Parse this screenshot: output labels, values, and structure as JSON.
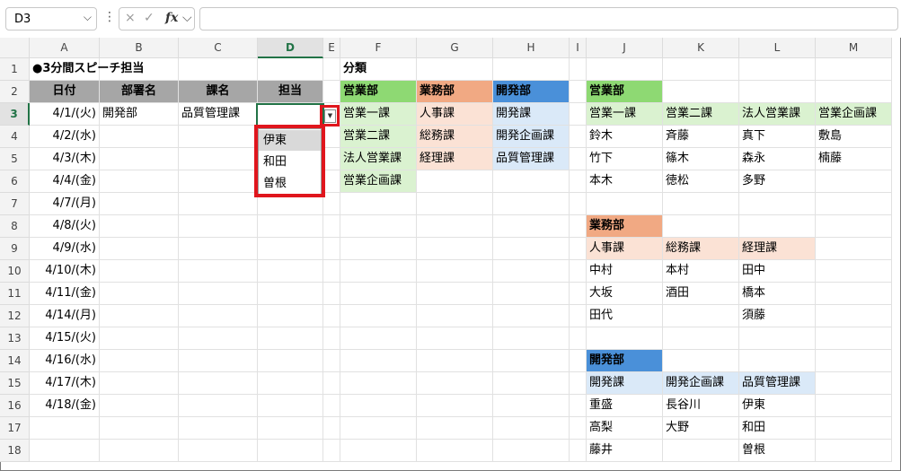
{
  "formula_bar": {
    "name_box": "D3",
    "name_box_dropdown": "chevron-down",
    "menu_dots": "⋮",
    "cancel_icon": "×",
    "enter_icon": "✓",
    "fx_label": "fx",
    "fx_dropdown": "chevron-down",
    "formula_value": ""
  },
  "columns": [
    "A",
    "B",
    "C",
    "D",
    "E",
    "F",
    "G",
    "H",
    "I",
    "J",
    "K",
    "L",
    "M"
  ],
  "selected_column": "D",
  "rows": [
    "1",
    "2",
    "3",
    "4",
    "5",
    "6",
    "7",
    "8",
    "9",
    "10",
    "11",
    "12",
    "13",
    "14",
    "15",
    "16",
    "17",
    "18"
  ],
  "selected_row": "3",
  "left_table": {
    "title": "●3分間スピーチ担当",
    "headers": [
      "日付",
      "部署名",
      "課名",
      "担当"
    ],
    "dates": [
      "4/1/(火)",
      "4/2/(水)",
      "4/3/(木)",
      "4/4/(金)",
      "4/7/(月)",
      "4/8/(火)",
      "4/9/(水)",
      "4/10/(木)",
      "4/11/(金)",
      "4/14/(月)",
      "4/15/(火)",
      "4/16/(水)",
      "4/17/(木)",
      "4/18/(金)"
    ],
    "row3_dept": "開発部",
    "row3_section": "品質管理課"
  },
  "classification": {
    "title": "分類",
    "headers": [
      "営業部",
      "業務部",
      "開発部"
    ],
    "eigyo": [
      "営業一課",
      "営業二課",
      "法人営業課",
      "営業企画課"
    ],
    "gyomu": [
      "人事課",
      "総務課",
      "経理課"
    ],
    "kaihatsu": [
      "開発課",
      "開発企画課",
      "品質管理課"
    ]
  },
  "right_tables": {
    "eigyo": {
      "header": "営業部",
      "sections": [
        "営業一課",
        "営業二課",
        "法人営業課",
        "営業企画課"
      ],
      "rows": [
        [
          "鈴木",
          "斉藤",
          "真下",
          "敷島"
        ],
        [
          "竹下",
          "篠木",
          "森永",
          "楠藤"
        ],
        [
          "本木",
          "徳松",
          "多野",
          ""
        ]
      ]
    },
    "gyomu": {
      "header": "業務部",
      "sections": [
        "人事課",
        "総務課",
        "経理課"
      ],
      "rows": [
        [
          "中村",
          "本村",
          "田中"
        ],
        [
          "大坂",
          "酒田",
          "橋本"
        ],
        [
          "田代",
          "",
          "須藤"
        ]
      ]
    },
    "kaihatsu": {
      "header": "開発部",
      "sections": [
        "開発課",
        "開発企画課",
        "品質管理課"
      ],
      "rows": [
        [
          "重盛",
          "長谷川",
          "伊東"
        ],
        [
          "高梨",
          "大野",
          "和田"
        ],
        [
          "藤井",
          "",
          "曽根"
        ]
      ]
    }
  },
  "dropdown": {
    "options": [
      "伊東",
      "和田",
      "曽根"
    ],
    "highlighted_index": 0,
    "button_glyph": "▼"
  },
  "colors": {
    "selection_green": "#217346",
    "highlight_red": "#e0161d",
    "eigyo_dark": "#8ed973",
    "eigyo_light": "#daf2d0",
    "gyomu_dark": "#f1a983",
    "gyomu_light": "#fbe2d5",
    "kaihatsu_dark": "#4a90d9",
    "kaihatsu_light": "#dae9f8",
    "header_gray": "#a6a6a6"
  }
}
